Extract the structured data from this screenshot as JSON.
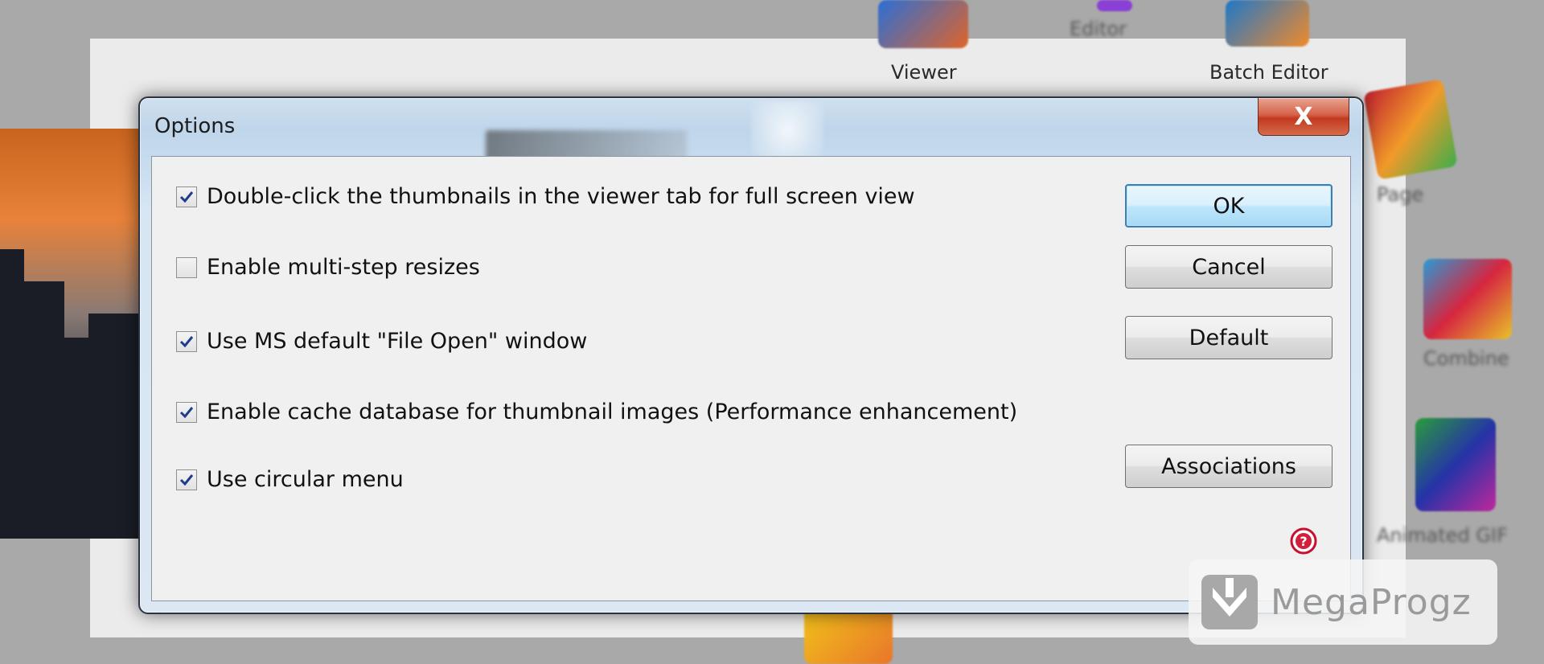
{
  "desktop": {
    "icons": [
      {
        "label": "Viewer",
        "icon": "viewer-icon"
      },
      {
        "label": "Editor",
        "icon": "editor-icon"
      },
      {
        "label": "Batch Editor",
        "icon": "batch-editor-icon"
      },
      {
        "label": "Page",
        "icon": "page-icon"
      },
      {
        "label": "Combine",
        "icon": "combine-icon"
      },
      {
        "label": "Animated GIF",
        "icon": "animated-gif-icon"
      }
    ]
  },
  "dialog": {
    "title": "Options",
    "close_label": "X",
    "options": [
      {
        "label": "Double-click the thumbnails in the viewer tab for full screen view",
        "checked": true
      },
      {
        "label": "Enable multi-step resizes",
        "checked": false
      },
      {
        "label": "Use MS default \"File Open\" window",
        "checked": true
      },
      {
        "label": "Enable cache database for thumbnail images (Performance enhancement)",
        "checked": true
      },
      {
        "label": "Use circular menu",
        "checked": true
      }
    ],
    "buttons": {
      "ok": "OK",
      "cancel": "Cancel",
      "default": "Default",
      "associations": "Associations"
    },
    "help_icon": "help-icon"
  },
  "watermark": {
    "text": "MegaProgz",
    "icon": "megaprogz-logo-icon"
  },
  "colors": {
    "accent": "#3c7fb1",
    "close": "#c2391f",
    "checkmark": "#1f3d8a"
  }
}
